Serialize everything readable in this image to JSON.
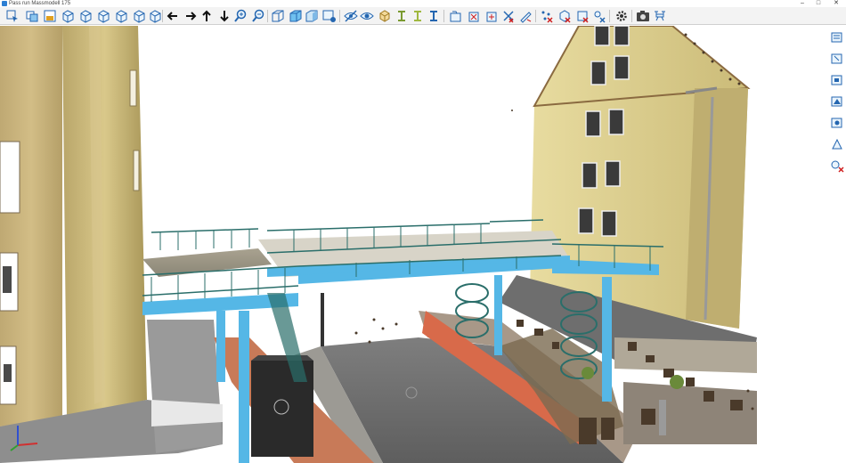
{
  "window": {
    "title": "Pass run Massmodell 175",
    "minimize_glyph": "–",
    "maximize_glyph": "□",
    "close_glyph": "✕"
  },
  "toolbar": {
    "items": [
      {
        "icon": "select-icon"
      },
      {
        "icon": "view-front-icon"
      },
      {
        "icon": "view-back-icon"
      },
      {
        "icon": "cube-view-1-icon"
      },
      {
        "icon": "cube-view-2-icon"
      },
      {
        "icon": "cube-view-3-icon"
      },
      {
        "icon": "cube-view-4-icon"
      },
      {
        "icon": "cube-view-5-icon"
      },
      {
        "icon": "arrow-left-icon"
      },
      {
        "icon": "arrow-right-icon"
      },
      {
        "icon": "arrow-up-icon"
      },
      {
        "icon": "arrow-down-icon"
      },
      {
        "icon": "zoom-in-icon"
      },
      {
        "icon": "zoom-out-icon"
      },
      {
        "icon": "wireframe-cube-icon"
      },
      {
        "icon": "solid-cube-icon"
      },
      {
        "icon": "shaded-cube-icon"
      },
      {
        "icon": "render-settings-icon"
      },
      {
        "icon": "hide-icon"
      },
      {
        "icon": "show-icon"
      },
      {
        "icon": "box-icon"
      },
      {
        "icon": "section-i-icon"
      },
      {
        "icon": "section-ii-icon"
      },
      {
        "icon": "section-iii-icon"
      },
      {
        "icon": "layer-open-icon"
      },
      {
        "icon": "layer-delete-icon"
      },
      {
        "icon": "layer-add-icon"
      },
      {
        "icon": "layer-remove-icon"
      },
      {
        "icon": "layer-clean-icon"
      },
      {
        "icon": "points-1-icon"
      },
      {
        "icon": "points-2-icon"
      },
      {
        "icon": "points-3-icon"
      },
      {
        "icon": "points-4-icon"
      },
      {
        "icon": "settings-icon"
      },
      {
        "icon": "camera-icon"
      },
      {
        "icon": "drone-icon"
      }
    ]
  },
  "side_tools": {
    "items": [
      {
        "icon": "side-tool-1-icon"
      },
      {
        "icon": "side-tool-2-icon"
      },
      {
        "icon": "side-tool-3-icon"
      },
      {
        "icon": "side-tool-4-icon"
      },
      {
        "icon": "side-tool-5-icon"
      },
      {
        "icon": "side-tool-6-icon"
      },
      {
        "icon": "side-tool-7-icon"
      }
    ]
  },
  "axis_gizmo": {
    "x_color": "#d03030",
    "y_color": "#30a030",
    "z_color": "#3050d0"
  },
  "colors": {
    "steel_blue": "#55b7e6",
    "facade": "#e8dca0",
    "railing": "#2a6e6a"
  }
}
